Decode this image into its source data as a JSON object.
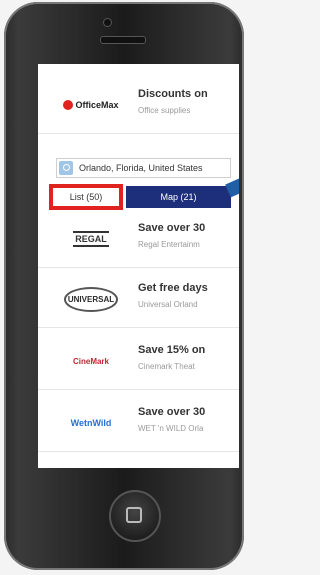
{
  "header": {
    "brand": "OfficeMax",
    "title": "Discounts on",
    "subtitle": "Office supplies"
  },
  "search": {
    "location": "Orlando, Florida, United States"
  },
  "tabs": {
    "list_label": "List (50)",
    "map_label": "Map (21)"
  },
  "deals": [
    {
      "brand": "REGAL",
      "title": "Save over 30",
      "subtitle": "Regal Entertainm"
    },
    {
      "brand": "UNIVERSAL",
      "title": "Get free days",
      "subtitle": "Universal Orland"
    },
    {
      "brand": "CineMark",
      "title": "Save 15% on",
      "subtitle": "Cinemark Theat"
    },
    {
      "brand": "WetnWild",
      "title": "Save over 30",
      "subtitle": "WET 'n WILD Orla"
    }
  ],
  "colors": {
    "highlight": "#e0231f",
    "map_tab": "#1d2f7a",
    "arrow": "#1f5fa8"
  }
}
